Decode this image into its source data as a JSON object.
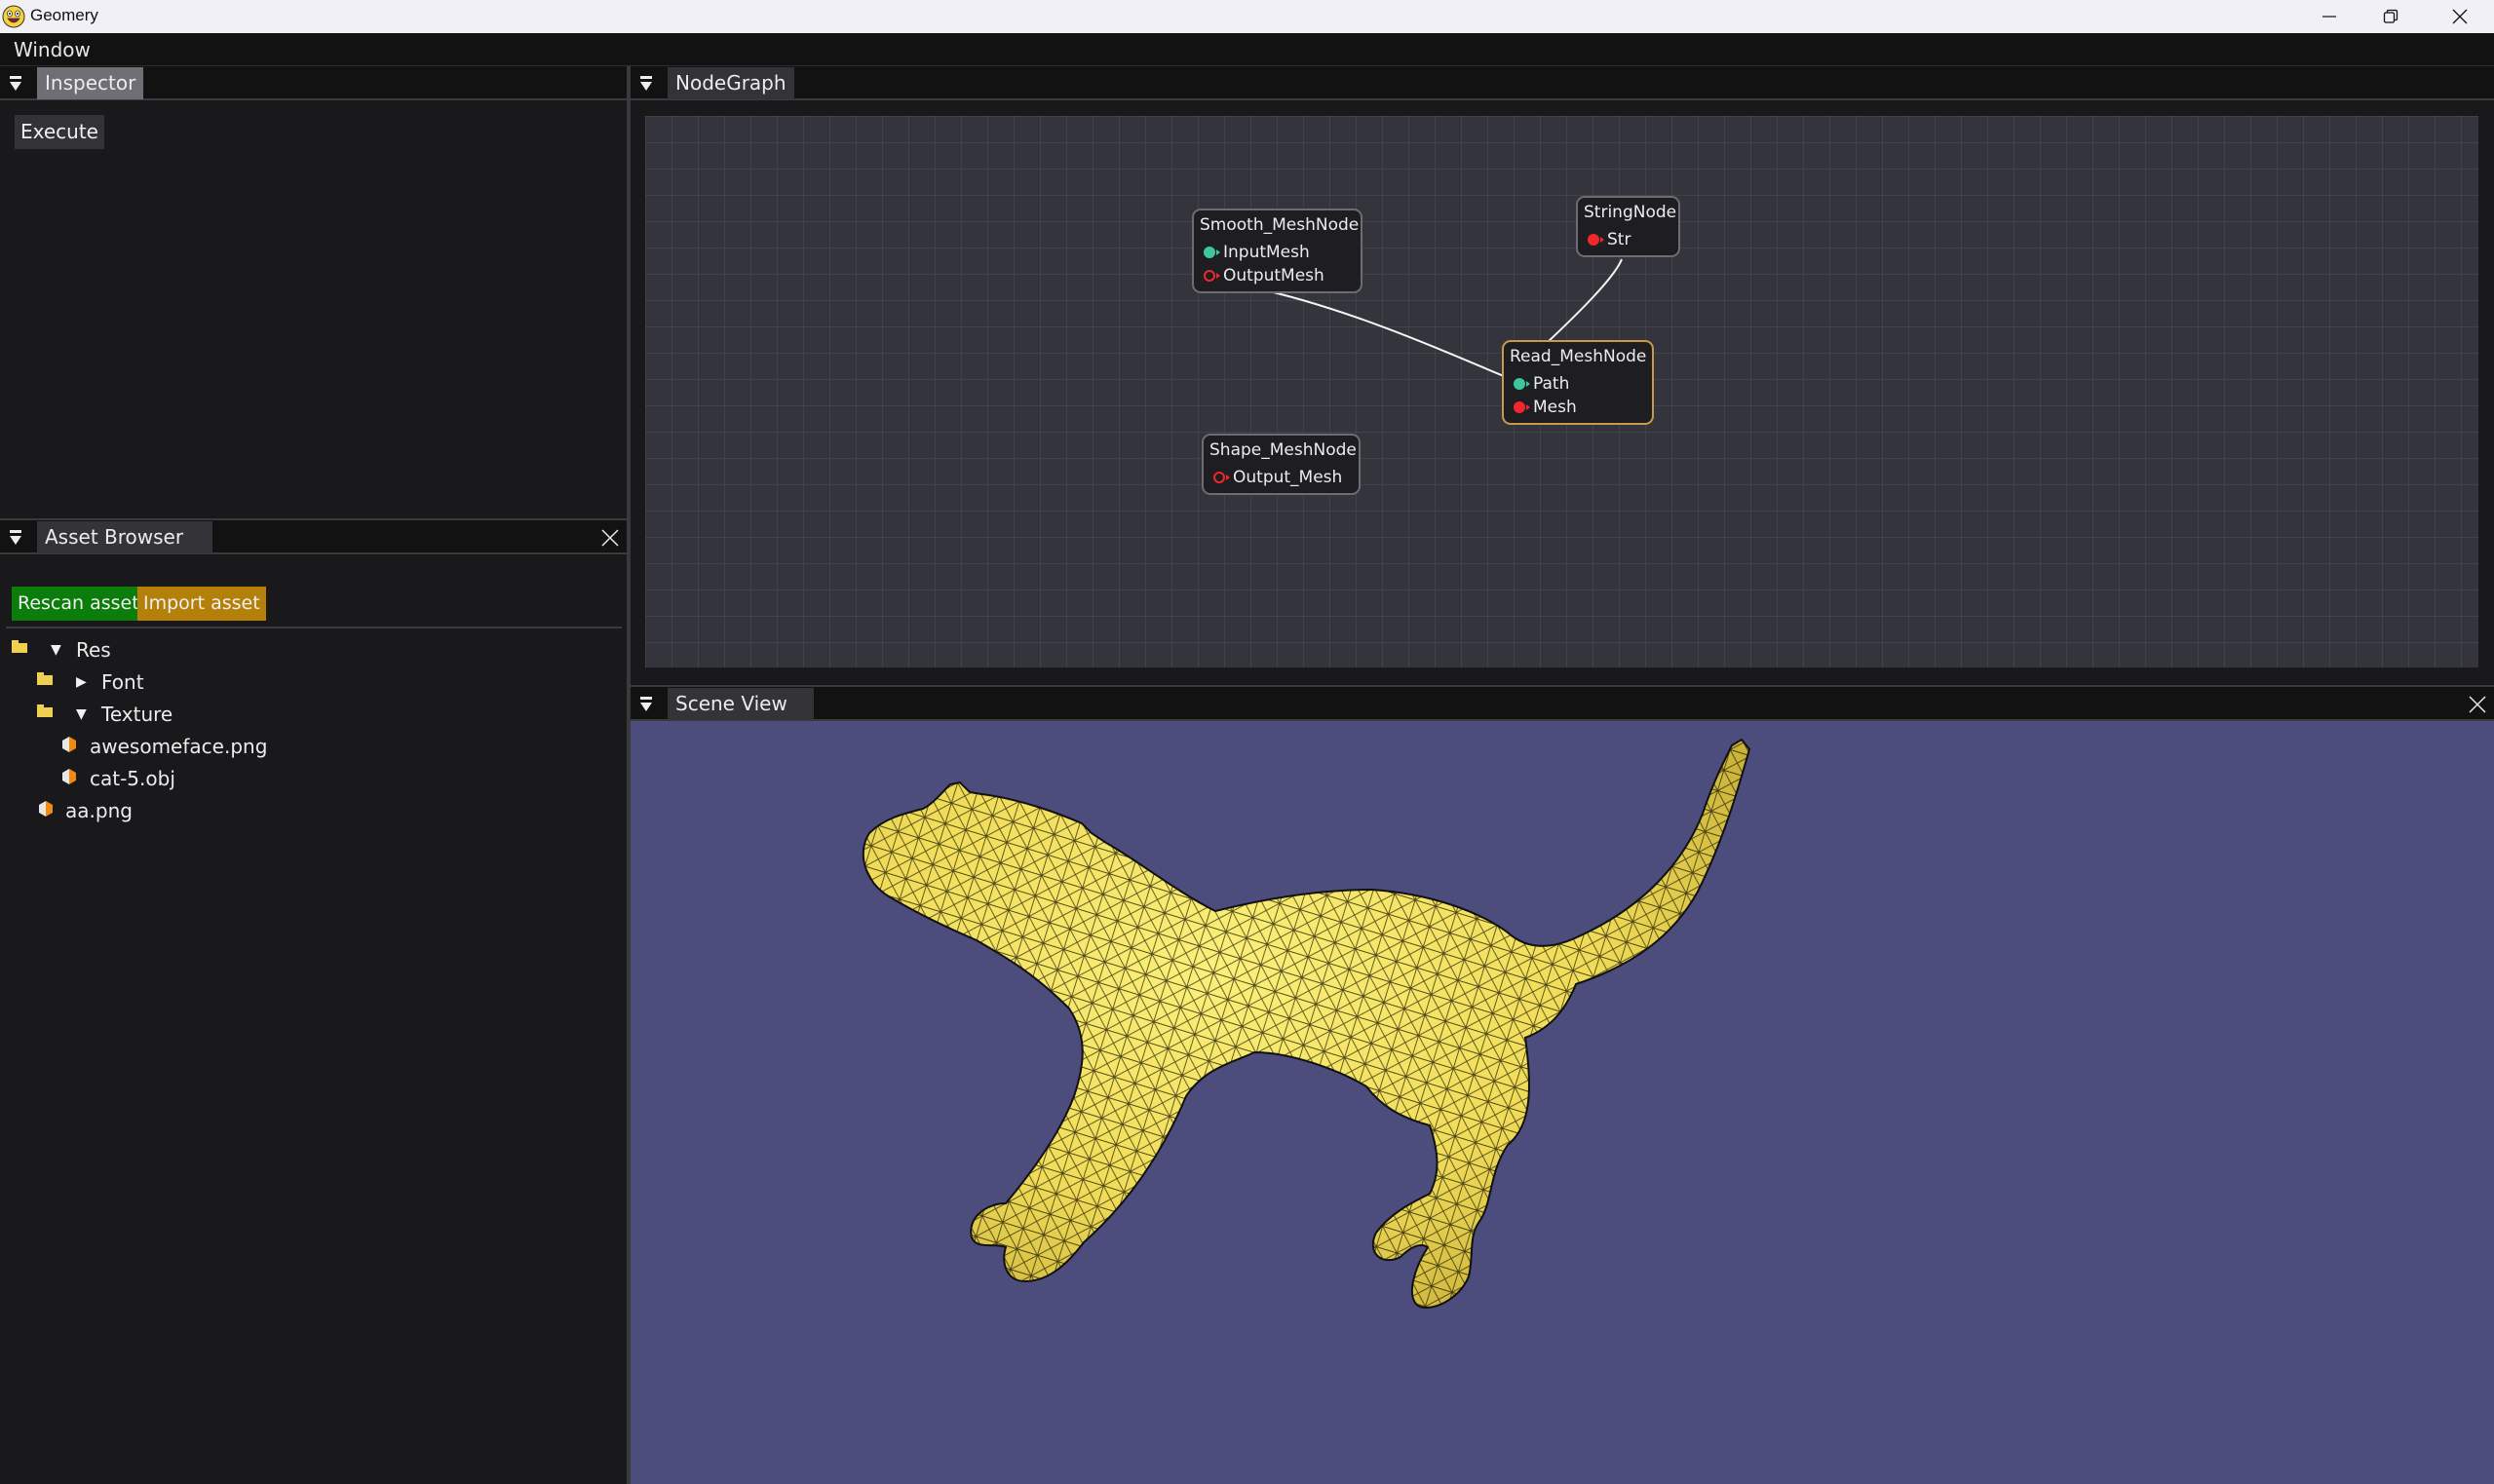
{
  "window": {
    "title": "Geomery",
    "app_icon": "awesomeface-icon",
    "controls": [
      "minimize-icon",
      "restore-icon",
      "close-icon"
    ]
  },
  "menubar": {
    "items": [
      "Window"
    ]
  },
  "inspector": {
    "tab_label": "Inspector",
    "execute_label": "Execute"
  },
  "asset_browser": {
    "tab_label": "Asset Browser",
    "rescan_label": "Rescan assets",
    "import_label": "Import asset",
    "colors": {
      "rescan": "#0a7d0a",
      "import": "#b5800a"
    },
    "tree": [
      {
        "label": "Res",
        "type": "folder",
        "expanded": true,
        "depth": 0
      },
      {
        "label": "Font",
        "type": "folder",
        "expanded": false,
        "depth": 1
      },
      {
        "label": "Texture",
        "type": "folder",
        "expanded": true,
        "depth": 1
      },
      {
        "label": "awesomeface.png",
        "type": "file",
        "depth": 2
      },
      {
        "label": "cat-5.obj",
        "type": "file",
        "depth": 2
      },
      {
        "label": "aa.png",
        "type": "file",
        "depth": 1
      }
    ]
  },
  "node_graph": {
    "tab_label": "NodeGraph",
    "nodes": [
      {
        "id": "smooth",
        "title": "Smooth_MeshNode",
        "selected": false,
        "pins": [
          {
            "label": "InputMesh",
            "kind": "input",
            "connected": true
          },
          {
            "label": "OutputMesh",
            "kind": "output",
            "connected": false
          }
        ]
      },
      {
        "id": "string",
        "title": "StringNode",
        "selected": false,
        "pins": [
          {
            "label": "Str",
            "kind": "output",
            "connected": true
          }
        ]
      },
      {
        "id": "read",
        "title": "Read_MeshNode",
        "selected": true,
        "pins": [
          {
            "label": "Path",
            "kind": "input",
            "connected": true
          },
          {
            "label": "Mesh",
            "kind": "output",
            "connected": true
          }
        ]
      },
      {
        "id": "shape",
        "title": "Shape_MeshNode",
        "selected": false,
        "pins": [
          {
            "label": "Output_Mesh",
            "kind": "output",
            "connected": false
          }
        ]
      }
    ],
    "links": [
      {
        "from": "read.Mesh",
        "to": "smooth.InputMesh"
      },
      {
        "from": "string.Str",
        "to": "read.Path"
      }
    ],
    "pin_colors": {
      "input": "#3ec79a",
      "output": "#f0282d"
    }
  },
  "scene_view": {
    "tab_label": "Scene View",
    "background": "#4c4d7d",
    "mesh": {
      "name": "cat-5.obj",
      "color": "#f2e160",
      "wireframe": true
    }
  }
}
